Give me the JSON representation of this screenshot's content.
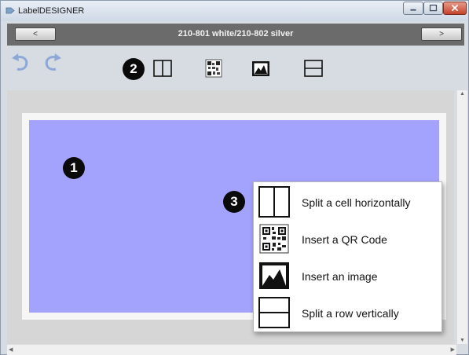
{
  "window": {
    "title": "LabelDESIGNER"
  },
  "header": {
    "prev_label": "<",
    "next_label": ">",
    "document_title": "210-801 white/210-802 silver"
  },
  "toolbar": {
    "icons": [
      "undo-icon",
      "redo-icon",
      "split-cell-horizontal-icon",
      "qr-code-icon",
      "image-icon",
      "split-row-vertical-icon"
    ]
  },
  "callouts": {
    "one": "1",
    "two": "2",
    "three": "3"
  },
  "canvas": {
    "color": "#a3a3fe"
  },
  "context_menu": {
    "items": [
      {
        "label": "Split a cell horizontally",
        "icon": "split-cell-horizontal-icon"
      },
      {
        "label": "Insert a QR Code",
        "icon": "qr-code-icon"
      },
      {
        "label": "Insert an image",
        "icon": "image-icon"
      },
      {
        "label": "Split a row vertically",
        "icon": "split-row-vertical-icon"
      }
    ]
  },
  "colors": {
    "header_bar": "#6b6b6b",
    "close_button": "#c4432c"
  }
}
